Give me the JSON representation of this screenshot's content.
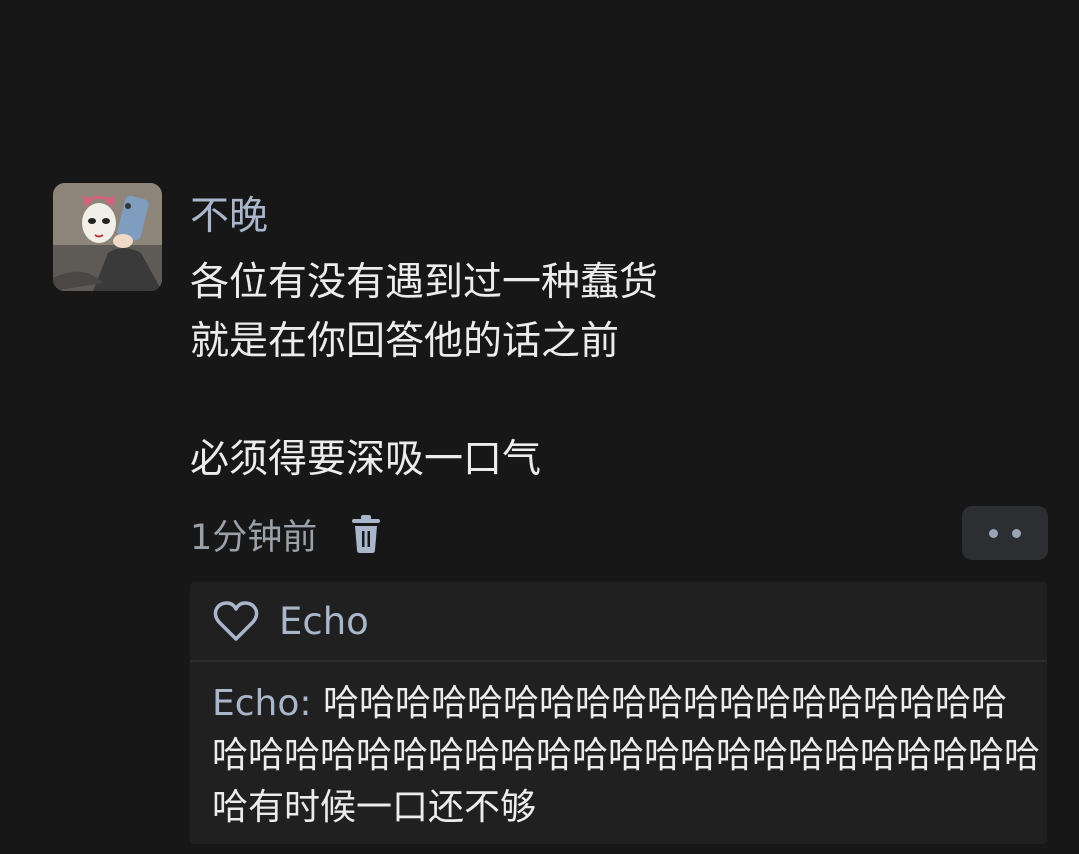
{
  "post": {
    "username": "不晚",
    "lines": [
      "各位有没有遇到过一种蠢货",
      "就是在你回答他的话之前",
      "",
      "必须得要深吸一口气"
    ],
    "timestamp": "1分钟前"
  },
  "icons": {
    "delete": "trash-icon",
    "more": "more-dots-icon",
    "like": "heart-icon",
    "avatar": "user-avatar-image"
  },
  "likes": {
    "liker": "Echo"
  },
  "reply": {
    "author": "Echo:",
    "text": " 哈哈哈哈哈哈哈哈哈哈哈哈哈哈哈哈哈哈哈哈哈哈哈哈哈哈哈哈哈哈哈哈哈哈哈哈哈哈哈哈哈哈哈有时候一口还不够"
  },
  "colors": {
    "background": "#171717",
    "accent": "#a9b7cc",
    "reply_box": "#202020"
  }
}
